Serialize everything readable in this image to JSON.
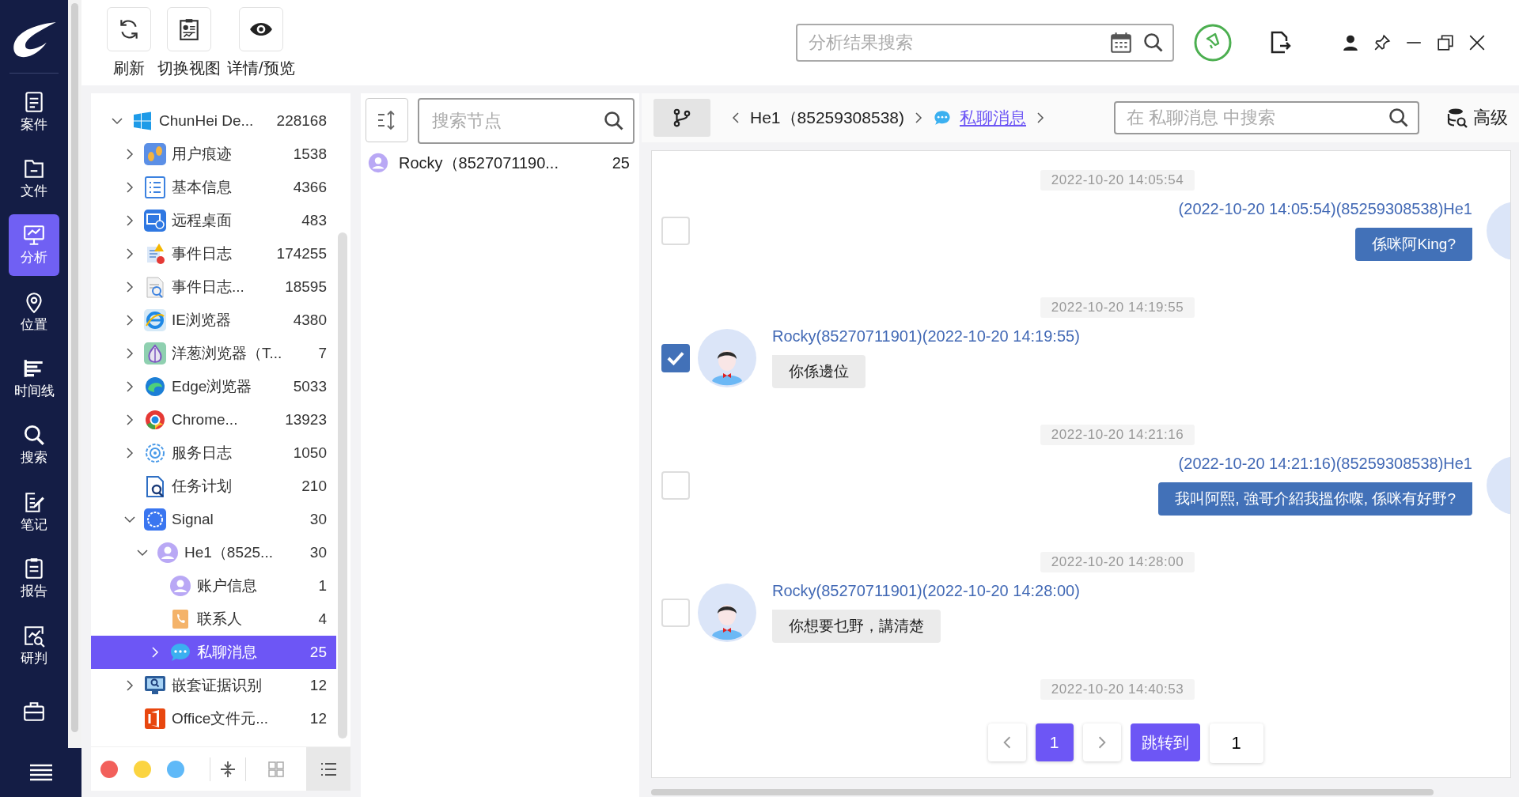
{
  "nav": {
    "items": [
      {
        "label": "案件",
        "selected": false
      },
      {
        "label": "文件",
        "selected": false
      },
      {
        "label": "分析",
        "selected": true
      },
      {
        "label": "位置",
        "selected": false
      },
      {
        "label": "时间线",
        "selected": false
      },
      {
        "label": "搜索",
        "selected": false
      },
      {
        "label": "笔记",
        "selected": false
      },
      {
        "label": "报告",
        "selected": false
      },
      {
        "label": "研判",
        "selected": false
      },
      {
        "selected": false
      }
    ]
  },
  "toolbar": {
    "buttons": [
      {
        "label": "刷新"
      },
      {
        "label": "切换视图"
      },
      {
        "label": "详情/预览"
      }
    ]
  },
  "top_search": {
    "placeholder": "分析结果搜索"
  },
  "tree": {
    "items": [
      {
        "label": "ChunHei De...",
        "count": "228168",
        "expanded": true,
        "selected": false,
        "children": [
          {
            "label": "用户痕迹",
            "count": "1538",
            "expanded": false,
            "selected": false
          },
          {
            "label": "基本信息",
            "count": "4366",
            "expanded": false,
            "selected": false
          },
          {
            "label": "远程桌面",
            "count": "483",
            "expanded": false,
            "selected": false
          },
          {
            "label": "事件日志",
            "count": "174255",
            "expanded": false,
            "selected": false
          },
          {
            "label": "事件日志...",
            "count": "18595",
            "expanded": false,
            "selected": false
          },
          {
            "label": "IE浏览器",
            "count": "4380",
            "expanded": false,
            "selected": false
          },
          {
            "label": "洋葱浏览器（T...",
            "count": "7",
            "expanded": false,
            "selected": false
          },
          {
            "label": "Edge浏览器",
            "count": "5033",
            "expanded": false,
            "selected": false
          },
          {
            "label": "Chrome...",
            "count": "13923",
            "expanded": false,
            "selected": false
          },
          {
            "label": "服务日志",
            "count": "1050",
            "expanded": false,
            "selected": false
          },
          {
            "label": "任务计划",
            "count": "210",
            "selected": false
          },
          {
            "label": "Signal",
            "count": "30",
            "expanded": true,
            "selected": false,
            "children": [
              {
                "label": "He1（8525...",
                "count": "30",
                "expanded": true,
                "selected": false,
                "children": [
                  {
                    "label": "账户信息",
                    "count": "1",
                    "selected": false
                  },
                  {
                    "label": "联系人",
                    "count": "4",
                    "selected": false
                  },
                  {
                    "label": "私聊消息",
                    "count": "25",
                    "expanded": false,
                    "selected": true
                  }
                ]
              }
            ]
          },
          {
            "label": "嵌套证据识别",
            "count": "12",
            "expanded": false,
            "selected": false
          },
          {
            "label": "Office文件元...",
            "count": "12",
            "selected": false
          }
        ]
      }
    ],
    "filters": [
      {
        "color": "#f2605b"
      },
      {
        "color": "#fbd440"
      },
      {
        "color": "#5fb9f8"
      }
    ],
    "views": [
      {
        "selected": false
      },
      {
        "selected": true
      }
    ]
  },
  "nodes": {
    "search": {
      "placeholder": "搜索节点"
    },
    "items": [
      {
        "label": "Rocky（8527071190...",
        "count": "25"
      }
    ]
  },
  "chat": {
    "breadcrumb": [
      {
        "kind": "text",
        "label": "He1（85259308538)"
      },
      {
        "kind": "link",
        "label": "私聊消息"
      }
    ],
    "search": {
      "placeholder": "在 私聊消息 中搜索"
    },
    "advanced_label": "高级",
    "messages": [
      {
        "kind": "timestamp",
        "text": "2022-10-20 14:05:54"
      },
      {
        "kind": "outgoing",
        "header": "(2022-10-20 14:05:54)(85259308538)He1",
        "text": "係咪阿King?",
        "checked": false
      },
      {
        "kind": "timestamp",
        "text": "2022-10-20 14:19:55"
      },
      {
        "kind": "incoming",
        "header": "Rocky(85270711901)(2022-10-20 14:19:55)",
        "text": "你係邊位",
        "checked": true
      },
      {
        "kind": "timestamp",
        "text": "2022-10-20 14:21:16"
      },
      {
        "kind": "outgoing",
        "header": "(2022-10-20 14:21:16)(85259308538)He1",
        "text": "我叫阿熙, 強哥介紹我搵你㗎, 係咪有好野?",
        "checked": false
      },
      {
        "kind": "timestamp",
        "text": "2022-10-20 14:28:00"
      },
      {
        "kind": "incoming",
        "header": "Rocky(85270711901)(2022-10-20 14:28:00)",
        "text": "你想要乜野，講清楚",
        "checked": false
      },
      {
        "kind": "timestamp",
        "text": "2022-10-20 14:40:53"
      }
    ],
    "pagination": {
      "pages": [
        {
          "label": "1",
          "selected": true
        }
      ],
      "jump_label": "跳转到",
      "jump_value": "1"
    }
  }
}
